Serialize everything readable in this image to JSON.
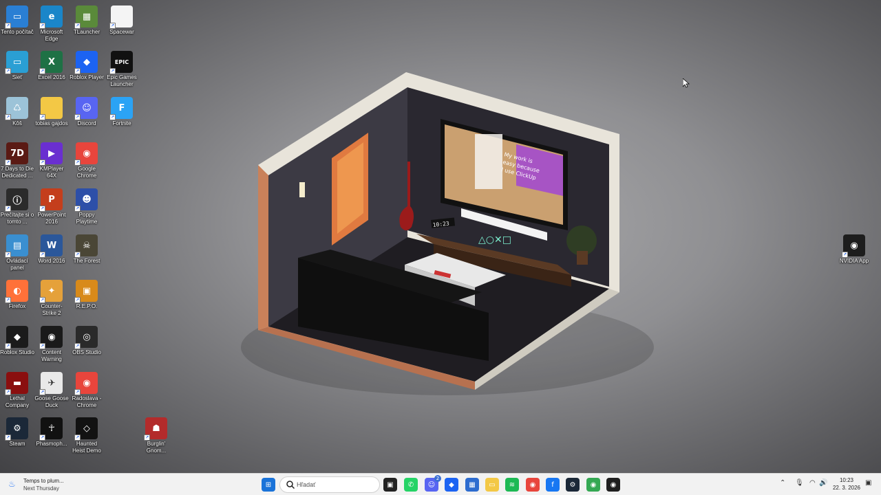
{
  "desktop_icons": [
    {
      "label": "Tento počítač",
      "icon": "computer-icon",
      "color": "#2a7fd4",
      "glyph": "▭"
    },
    {
      "label": "Microsoft Edge",
      "icon": "edge-icon",
      "color": "#1a86c9",
      "glyph": "e"
    },
    {
      "label": "TLauncher",
      "icon": "minecraft-block-icon",
      "color": "#5a8a3a",
      "glyph": "▦"
    },
    {
      "label": "Spacewar",
      "icon": "file-icon",
      "color": "#f4f4f4",
      "glyph": ""
    },
    {
      "label": "Sieť",
      "icon": "network-icon",
      "color": "#2a9fd4",
      "glyph": "▭"
    },
    {
      "label": "Excel 2016",
      "icon": "excel-icon",
      "color": "#1e7145",
      "glyph": "X"
    },
    {
      "label": "Roblox Player",
      "icon": "roblox-icon",
      "color": "#1c63f2",
      "glyph": "◆"
    },
    {
      "label": "Epic Games Launcher",
      "icon": "epic-games-icon",
      "color": "#111111",
      "glyph": "EPIC"
    },
    {
      "label": "Kôš",
      "icon": "recycle-bin-icon",
      "color": "#9cc3d8",
      "glyph": "♺"
    },
    {
      "label": "tobias gajdos",
      "icon": "folder-icon",
      "color": "#f3c845",
      "glyph": ""
    },
    {
      "label": "Discord",
      "icon": "discord-icon",
      "color": "#5865f2",
      "glyph": "☺"
    },
    {
      "label": "Fortnite",
      "icon": "fortnite-icon",
      "color": "#2ba3f5",
      "glyph": "F"
    },
    {
      "label": "7 Days to Die Dedicated ...",
      "icon": "7-days-icon",
      "color": "#5a1a14",
      "glyph": "7D"
    },
    {
      "label": "KMPlayer 64X",
      "icon": "kmplayer-icon",
      "color": "#6a2fd0",
      "glyph": "▶"
    },
    {
      "label": "Google Chrome",
      "icon": "chrome-icon",
      "color": "#e8453c",
      "glyph": "◉"
    },
    {
      "label": "Prečítajte si o tomto ...",
      "icon": "info-icon",
      "color": "#2b2b2b",
      "glyph": "ⓘ"
    },
    {
      "label": "PowerPoint 2016",
      "icon": "powerpoint-icon",
      "color": "#c43e1c",
      "glyph": "P"
    },
    {
      "label": "Poppy Playtime",
      "icon": "poppy-playtime-icon",
      "color": "#2d4fa8",
      "glyph": "☻"
    },
    {
      "label": "Ovládací panel",
      "icon": "control-panel-icon",
      "color": "#3a8fd0",
      "glyph": "▤"
    },
    {
      "label": "Word 2016",
      "icon": "word-icon",
      "color": "#2b579a",
      "glyph": "W"
    },
    {
      "label": "The Forest",
      "icon": "the-forest-icon",
      "color": "#4a4636",
      "glyph": "☠"
    },
    {
      "label": "Firefox",
      "icon": "firefox-icon",
      "color": "#ff7139",
      "glyph": "◐"
    },
    {
      "label": "Counter-Strike 2",
      "icon": "counter-strike-icon",
      "color": "#e5a13a",
      "glyph": "✦"
    },
    {
      "label": "R.E.P.O.",
      "icon": "repo-icon",
      "color": "#d88a1a",
      "glyph": "▣"
    },
    {
      "label": "Roblox Studio",
      "icon": "roblox-studio-icon",
      "color": "#1b1b1b",
      "glyph": "◆"
    },
    {
      "label": "Content Warning",
      "icon": "content-warning-icon",
      "color": "#1a1a1a",
      "glyph": "◉"
    },
    {
      "label": "OBS Studio",
      "icon": "obs-icon",
      "color": "#2a2a2a",
      "glyph": "◎"
    },
    {
      "label": "Lethal Company",
      "icon": "lethal-company-icon",
      "color": "#8a0f0f",
      "glyph": "▬"
    },
    {
      "label": "Goose Goose Duck",
      "icon": "goose-icon",
      "color": "#e9e9e9",
      "glyph": "✈"
    },
    {
      "label": "Radoslava - Chrome",
      "icon": "chrome-profile-icon",
      "color": "#e8453c",
      "glyph": "◉"
    },
    {
      "label": "Steam",
      "icon": "steam-icon",
      "color": "#1b2838",
      "glyph": "⚙"
    },
    {
      "label": "Phasmoph...",
      "icon": "phasmophobia-icon",
      "color": "#111111",
      "glyph": "☥"
    },
    {
      "label": "Haunted Heist Demo",
      "icon": "haunted-heist-icon",
      "color": "#121212",
      "glyph": "◇"
    },
    {
      "label": "Burglin' Gnom...",
      "icon": "burglin-gnomes-icon",
      "color": "#b32b2b",
      "glyph": "☗"
    },
    {
      "label": "NVIDIA App",
      "icon": "nvidia-icon",
      "color": "#1d1d1d",
      "glyph": "◉"
    }
  ],
  "room": {
    "clock_text": "10:23",
    "tv_text": [
      "My work is",
      "easy because",
      "I use ClickUp"
    ]
  },
  "taskbar": {
    "weather_line1": "Temps to plum...",
    "weather_line2": "Next Thursday",
    "search_placeholder": "Hľadať",
    "apps": [
      {
        "name": "start-icon",
        "color": "#1a73d9",
        "glyph": "⊞"
      },
      {
        "name": "task-view-icon",
        "color": "#222222",
        "glyph": "▣"
      },
      {
        "name": "whatsapp-icon",
        "color": "#25d366",
        "glyph": "✆"
      },
      {
        "name": "discord-icon",
        "color": "#5865f2",
        "glyph": "☺"
      },
      {
        "name": "roblox-studio-icon",
        "color": "#1c63f2",
        "glyph": "◆"
      },
      {
        "name": "calculator-icon",
        "color": "#2d6ccf",
        "glyph": "▦"
      },
      {
        "name": "file-explorer-icon",
        "color": "#f3c845",
        "glyph": "▭"
      },
      {
        "name": "spotify-icon",
        "color": "#1db954",
        "glyph": "≋"
      },
      {
        "name": "chrome-icon",
        "color": "#e8453c",
        "glyph": "◉"
      },
      {
        "name": "facebook-icon",
        "color": "#1877f2",
        "glyph": "f"
      },
      {
        "name": "steam-icon",
        "color": "#1b2838",
        "glyph": "⚙"
      },
      {
        "name": "chrome-profile-icon",
        "color": "#34a853",
        "glyph": "◉"
      },
      {
        "name": "github-icon",
        "color": "#1f1f1f",
        "glyph": "◉"
      }
    ],
    "discord_badge": "2",
    "clock_time": "10:23",
    "clock_date": "22. 3. 2026"
  }
}
